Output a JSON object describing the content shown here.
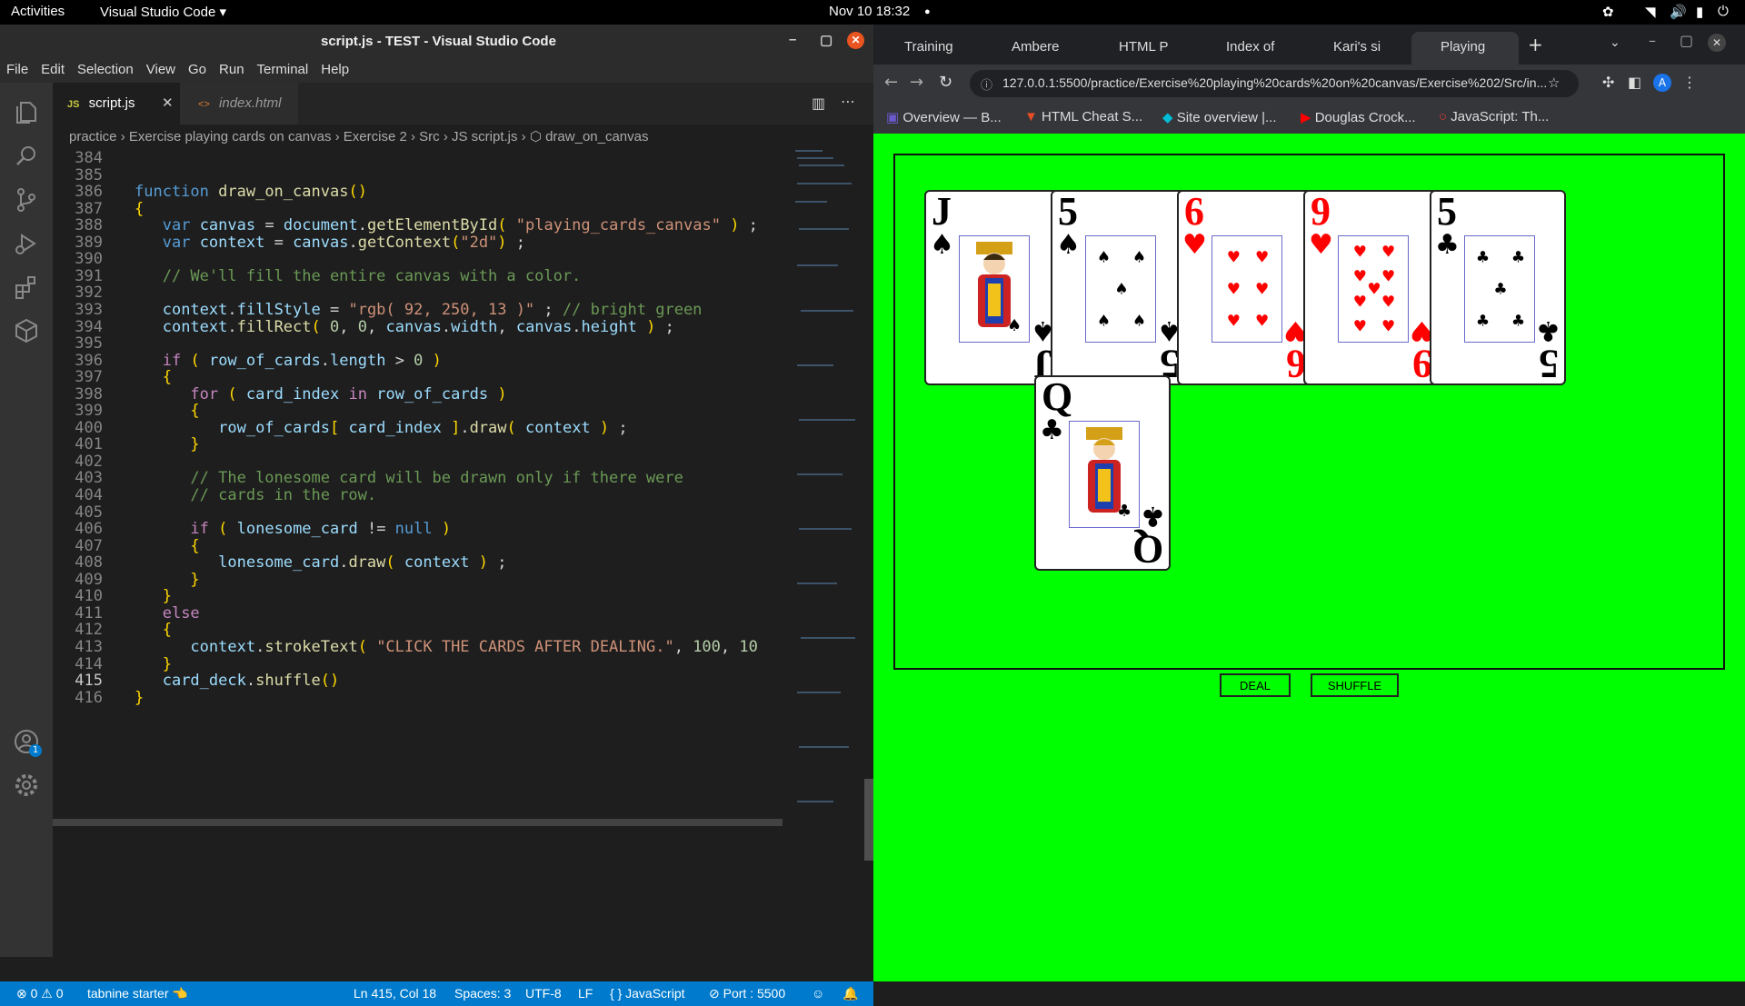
{
  "topbar": {
    "activities": "Activities",
    "app": "Visual Studio Code ▾",
    "clock": "Nov 10  18:32",
    "dot": "●"
  },
  "vscode": {
    "title": "script.js - TEST - Visual Studio Code",
    "menu": [
      "File",
      "Edit",
      "Selection",
      "View",
      "Go",
      "Run",
      "Terminal",
      "Help"
    ],
    "tabs": [
      {
        "label": "script.js",
        "icon": "JS",
        "active": true
      },
      {
        "label": "index.html",
        "icon": "<>",
        "active": false
      }
    ],
    "breadcrumb": "practice  ›  Exercise playing cards on canvas  ›  Exercise 2  ›  Src  ›  JS  script.js  ›  ⬡ draw_on_canvas",
    "lines": [
      {
        "n": "384",
        "t": ""
      },
      {
        "n": "385",
        "t": ""
      },
      {
        "n": "386",
        "t": "function draw_on_canvas()"
      },
      {
        "n": "387",
        "t": "{"
      },
      {
        "n": "388",
        "t": "   var canvas = document.getElementById( \"playing_cards_canvas\" ) ;"
      },
      {
        "n": "389",
        "t": "   var context = canvas.getContext(\"2d\") ;"
      },
      {
        "n": "390",
        "t": ""
      },
      {
        "n": "391",
        "t": "   // We'll fill the entire canvas with a color."
      },
      {
        "n": "392",
        "t": ""
      },
      {
        "n": "393",
        "t": "   context.fillStyle = \"rgb( 92, 250, 13 )\" ; // bright green"
      },
      {
        "n": "394",
        "t": "   context.fillRect( 0, 0, canvas.width, canvas.height ) ;"
      },
      {
        "n": "395",
        "t": ""
      },
      {
        "n": "396",
        "t": "   if ( row_of_cards.length > 0 )"
      },
      {
        "n": "397",
        "t": "   {"
      },
      {
        "n": "398",
        "t": "      for ( card_index in row_of_cards )"
      },
      {
        "n": "399",
        "t": "      {"
      },
      {
        "n": "400",
        "t": "         row_of_cards[ card_index ].draw( context ) ;"
      },
      {
        "n": "401",
        "t": "      }"
      },
      {
        "n": "402",
        "t": ""
      },
      {
        "n": "403",
        "t": "      // The lonesome card will be drawn only if there were"
      },
      {
        "n": "404",
        "t": "      // cards in the row."
      },
      {
        "n": "405",
        "t": ""
      },
      {
        "n": "406",
        "t": "      if ( lonesome_card != null )"
      },
      {
        "n": "407",
        "t": "      {"
      },
      {
        "n": "408",
        "t": "         lonesome_card.draw( context ) ;"
      },
      {
        "n": "409",
        "t": "      }"
      },
      {
        "n": "410",
        "t": "   }"
      },
      {
        "n": "411",
        "t": "   else"
      },
      {
        "n": "412",
        "t": "   {"
      },
      {
        "n": "413",
        "t": "      context.strokeText( \"CLICK THE CARDS AFTER DEALING.\", 100, 10"
      },
      {
        "n": "414",
        "t": "   }"
      },
      {
        "n": "415",
        "t": "   card_deck.shuffle()"
      },
      {
        "n": "416",
        "t": "}"
      }
    ],
    "status": {
      "errors": "⊗ 0  ⚠ 0",
      "tabnine": "tabnine starter 👈",
      "pos": "Ln 415, Col 18",
      "spaces": "Spaces: 3",
      "enc": "UTF-8",
      "eol": "LF",
      "lang": "{ }  JavaScript",
      "port": "⊘ Port : 5500"
    },
    "account_badge": "1"
  },
  "chrome": {
    "tabs": [
      "Training",
      "Ambere",
      "HTML P",
      "Index of",
      "Kari's si",
      "Playing"
    ],
    "url": "127.0.0.1:5500/practice/Exercise%20playing%20cards%20on%20canvas/Exercise%202/Src/in...",
    "profile": "A",
    "bookmarks": [
      "Overview — B...",
      "HTML Cheat S...",
      "Site overview |...",
      "Douglas Crock...",
      "JavaScript: Th..."
    ],
    "cards": [
      {
        "rank": "J",
        "suit": "♠",
        "color": "blk",
        "face": "jack"
      },
      {
        "rank": "5",
        "suit": "♠",
        "color": "blk",
        "pips": 5
      },
      {
        "rank": "6",
        "suit": "♥",
        "color": "red",
        "pips": 6
      },
      {
        "rank": "9",
        "suit": "♥",
        "color": "red",
        "pips": 9
      },
      {
        "rank": "5",
        "suit": "♣",
        "color": "blk",
        "pips": 5
      },
      {
        "rank": "Q",
        "suit": "♣",
        "color": "blk",
        "face": "queen"
      }
    ],
    "buttons": {
      "deal": "DEAL",
      "shuffle": "SHUFFLE"
    }
  }
}
